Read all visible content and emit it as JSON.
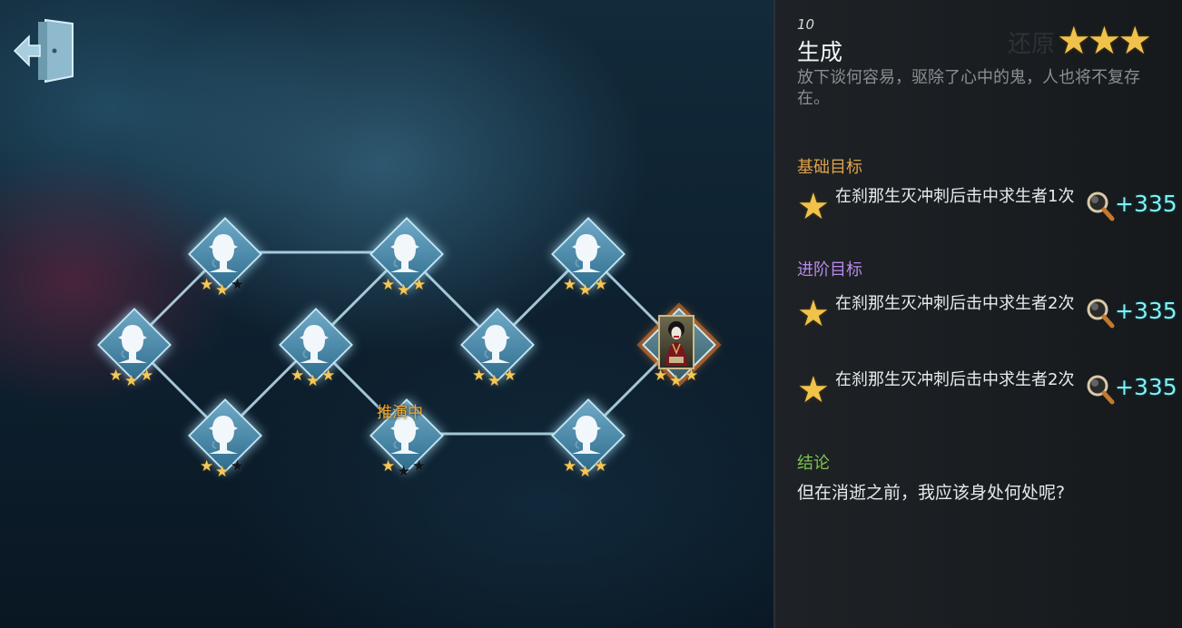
{
  "chapter": {
    "number": "10",
    "title": "生成",
    "description": "放下谈何容易，驱除了心中的鬼，人也将不复存在。",
    "stars_earned": 3
  },
  "objectives": {
    "basic": {
      "heading": "基础目标",
      "heading_color": "#e0a24a",
      "items": [
        {
          "text": "在刹那生灭冲刺后击中求生者1次",
          "reward": "+335"
        }
      ]
    },
    "advanced": {
      "heading": "进阶目标",
      "heading_color": "#b88ae8",
      "items": [
        {
          "text": "在刹那生灭冲刺后击中求生者2次",
          "reward": "+335"
        },
        {
          "text": "在刹那生灭冲刺后击中求生者2次",
          "reward": "+335"
        }
      ]
    }
  },
  "conclusion": {
    "heading": "结论",
    "heading_color": "#7fc24f",
    "text": "但在消逝之前，我应该身处何处呢?"
  },
  "map": {
    "in_progress_label": "推演中",
    "nodes": [
      {
        "id": "n1",
        "stars": 3,
        "icon": "detective-silhouette-icon"
      },
      {
        "id": "n2",
        "stars": 2,
        "icon": "detective-silhouette-icon"
      },
      {
        "id": "n3",
        "stars": 2,
        "icon": "detective-silhouette-icon"
      },
      {
        "id": "n4",
        "stars": 3,
        "icon": "detective-silhouette-icon"
      },
      {
        "id": "n5",
        "stars": 3,
        "icon": "detective-silhouette-icon"
      },
      {
        "id": "n6",
        "stars": 1,
        "icon": "detective-silhouette-icon",
        "in_progress": true
      },
      {
        "id": "n7",
        "stars": 3,
        "icon": "detective-silhouette-icon"
      },
      {
        "id": "n8",
        "stars": 3,
        "icon": "detective-silhouette-icon"
      },
      {
        "id": "n9",
        "stars": 3,
        "icon": "detective-silhouette-icon"
      },
      {
        "id": "n10",
        "stars": 3,
        "icon": "geisha-portrait-icon",
        "current": true
      }
    ]
  },
  "colors": {
    "star_gold": "#f3c85a",
    "reward_cyan": "#7ef0f5",
    "node_blue": "#4f8fb0",
    "current_highlight": "#e67828"
  }
}
